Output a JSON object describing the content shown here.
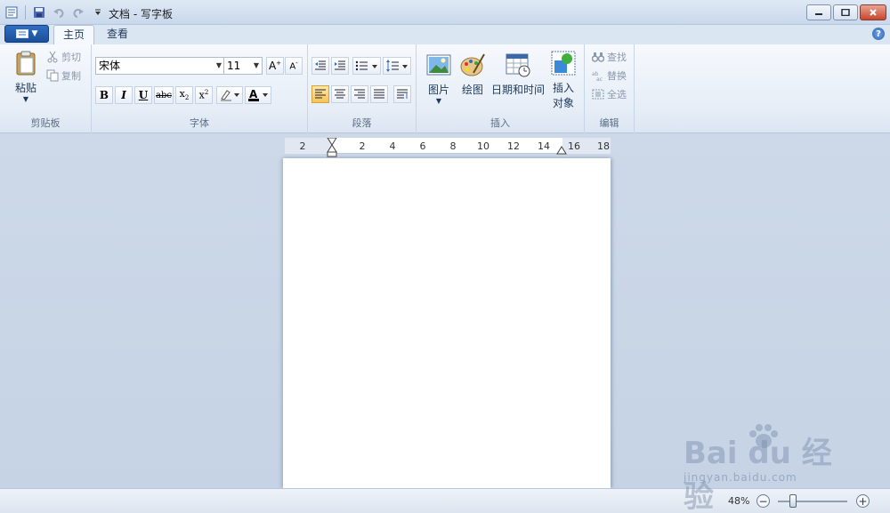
{
  "window": {
    "title": "文档 - 写字板"
  },
  "tabs": [
    {
      "label": "主页",
      "active": true
    },
    {
      "label": "查看",
      "active": false
    }
  ],
  "help_symbol": "?",
  "ribbon": {
    "clipboard": {
      "label": "剪贴板",
      "paste": "粘贴",
      "cut": "剪切",
      "copy": "复制"
    },
    "font": {
      "label": "字体",
      "font_name": "宋体",
      "font_size": "11",
      "bold": "B",
      "italic": "I",
      "underline": "U",
      "strike": "abc"
    },
    "paragraph": {
      "label": "段落"
    },
    "insert": {
      "label": "插入",
      "picture": "图片",
      "paint": "绘图",
      "datetime": "日期和时间",
      "object_line1": "插入",
      "object_line2": "对象"
    },
    "editing": {
      "label": "编辑",
      "find": "查找",
      "replace": "替换",
      "select_all": "全选"
    }
  },
  "ruler": {
    "ticks": [
      "2",
      "2",
      "4",
      "6",
      "8",
      "10",
      "12",
      "14",
      "16",
      "18"
    ]
  },
  "status": {
    "zoom": "48%",
    "zoom_out": "−",
    "zoom_in": "+"
  },
  "watermark": {
    "main": "Bai du 经验",
    "sub": "jingyan.baidu.com"
  },
  "colors": {
    "accent": "#2f6ec2",
    "ribbon_bg": "#e7eef7",
    "work_bg": "#cdd9e8"
  }
}
